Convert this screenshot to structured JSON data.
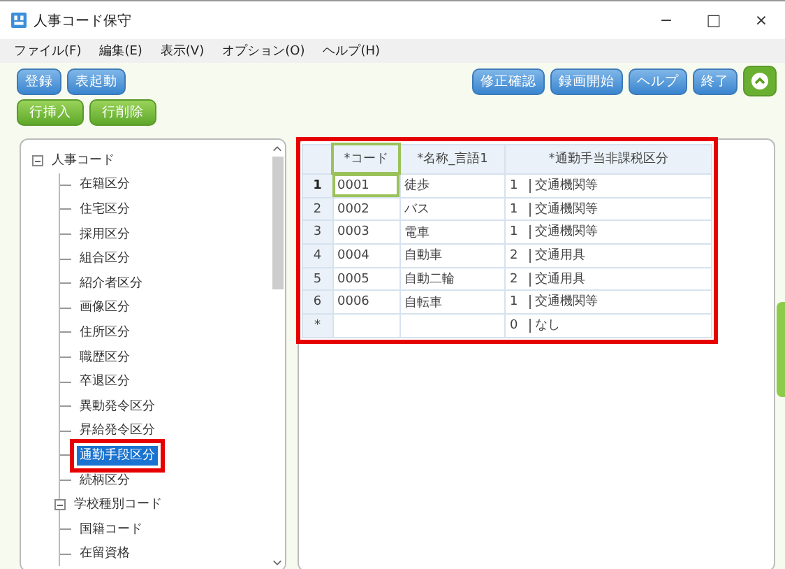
{
  "window": {
    "title": "人事コード保守",
    "controls": [
      "−",
      "□",
      "×"
    ]
  },
  "menu": [
    "ファイル(F)",
    "編集(E)",
    "表示(V)",
    "オプション(O)",
    "ヘルプ(H)"
  ],
  "toolbar": {
    "left_row1": [
      {
        "label": "登録",
        "kind": "blue"
      },
      {
        "label": "表起動",
        "kind": "blue"
      }
    ],
    "left_row2": [
      {
        "label": "行挿入",
        "kind": "green"
      },
      {
        "label": "行削除",
        "kind": "green"
      }
    ],
    "right": [
      {
        "label": "修正確認",
        "kind": "blue"
      },
      {
        "label": "録画開始",
        "kind": "blue"
      },
      {
        "label": "ヘルプ",
        "kind": "blue"
      },
      {
        "label": "終了",
        "kind": "blue"
      },
      {
        "kind": "menu"
      }
    ]
  },
  "tree": {
    "root": {
      "label": "人事コード",
      "expanded": true,
      "children": [
        {
          "label": "在籍区分",
          "selected": false,
          "annotated": false,
          "kind": "leaf"
        },
        {
          "label": "住宅区分",
          "selected": false,
          "annotated": false,
          "kind": "leaf"
        },
        {
          "label": "採用区分",
          "selected": false,
          "annotated": false,
          "kind": "leaf"
        },
        {
          "label": "組合区分",
          "selected": false,
          "annotated": false,
          "kind": "leaf"
        },
        {
          "label": "紹介者区分",
          "selected": false,
          "annotated": false,
          "kind": "leaf"
        },
        {
          "label": "画像区分",
          "selected": false,
          "annotated": false,
          "kind": "leaf"
        },
        {
          "label": "住所区分",
          "selected": false,
          "annotated": false,
          "kind": "leaf"
        },
        {
          "label": "職歴区分",
          "selected": false,
          "annotated": false,
          "kind": "leaf"
        },
        {
          "label": "卒退区分",
          "selected": false,
          "annotated": false,
          "kind": "leaf"
        },
        {
          "label": "異動発令区分",
          "selected": false,
          "annotated": false,
          "kind": "leaf"
        },
        {
          "label": "昇給発令区分",
          "selected": false,
          "annotated": false,
          "kind": "leaf"
        },
        {
          "label": "通勤手段区分",
          "selected": true,
          "annotated": true,
          "kind": "leaf"
        },
        {
          "label": "続柄区分",
          "selected": false,
          "annotated": false,
          "kind": "leaf"
        },
        {
          "label": "学校種別コード",
          "selected": false,
          "annotated": false,
          "kind": "group",
          "expanded": true
        },
        {
          "label": "国籍コード",
          "selected": false,
          "annotated": false,
          "kind": "leaf"
        },
        {
          "label": "在留資格",
          "selected": false,
          "annotated": false,
          "kind": "leaf"
        }
      ]
    }
  },
  "table": {
    "annotated": true,
    "columns": [
      "*コード",
      "*名称_言語1",
      "*通勤手当非課税区分"
    ],
    "rows": [
      {
        "header": "1",
        "code": "0001",
        "name": "徒歩",
        "value": "1",
        "value_label": "交通機関等",
        "selected": true
      },
      {
        "header": "2",
        "code": "0002",
        "name": "バス",
        "value": "1",
        "value_label": "交通機関等",
        "selected": false
      },
      {
        "header": "3",
        "code": "0003",
        "name": "電車",
        "value": "1",
        "value_label": "交通機関等",
        "selected": false
      },
      {
        "header": "4",
        "code": "0004",
        "name": "自動車",
        "value": "2",
        "value_label": "交通用具",
        "selected": false
      },
      {
        "header": "5",
        "code": "0005",
        "name": "自動二輪",
        "value": "2",
        "value_label": "交通用具",
        "selected": false
      },
      {
        "header": "6",
        "code": "0006",
        "name": "自転車",
        "value": "1",
        "value_label": "交通機関等",
        "selected": false
      },
      {
        "header": "*",
        "code": "",
        "name": "",
        "value": "0",
        "value_label": "なし",
        "selected": false
      }
    ]
  }
}
